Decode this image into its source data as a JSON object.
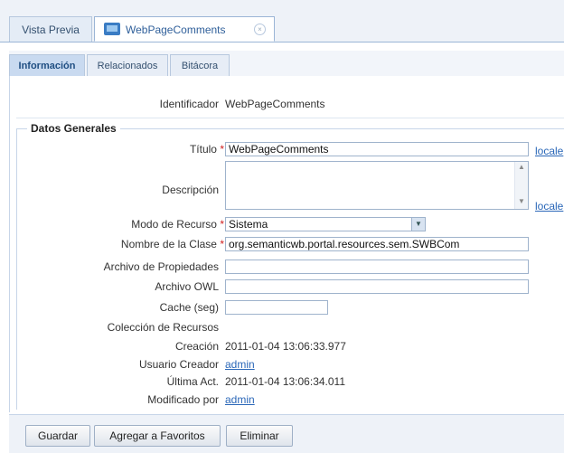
{
  "top_tabs": [
    {
      "label": "Vista Previa"
    },
    {
      "label": "WebPageComments"
    }
  ],
  "sub_tabs": [
    {
      "label": "Información"
    },
    {
      "label": "Relacionados"
    },
    {
      "label": "Bitácora"
    }
  ],
  "identificador": {
    "label": "Identificador",
    "value": "WebPageComments"
  },
  "section_title": "Datos Generales",
  "titulo": {
    "label": "Título",
    "value": "WebPageComments"
  },
  "descripcion": {
    "label": "Descripción",
    "value": ""
  },
  "locale_link": "locale",
  "modo_recurso": {
    "label": "Modo de Recurso",
    "value": "Sistema"
  },
  "nombre_clase": {
    "label": "Nombre de la Clase",
    "value": "org.semanticwb.portal.resources.sem.SWBCom"
  },
  "archivo_propiedades": {
    "label": "Archivo de Propiedades",
    "value": ""
  },
  "archivo_owl": {
    "label": "Archivo OWL",
    "value": ""
  },
  "cache": {
    "label": "Cache (seg)",
    "value": ""
  },
  "coleccion_recursos": {
    "label": "Colección de Recursos"
  },
  "creacion": {
    "label": "Creación",
    "value": "2011-01-04 13:06:33.977"
  },
  "usuario_creador": {
    "label": "Usuario Creador",
    "value": "admin"
  },
  "ultima_act": {
    "label": "Última Act.",
    "value": "2011-01-04 13:06:34.011"
  },
  "modificado_por": {
    "label": "Modificado por",
    "value": "admin"
  },
  "required_mark": "*",
  "buttons": {
    "guardar": "Guardar",
    "favoritos": "Agregar a Favoritos",
    "eliminar": "Eliminar"
  }
}
